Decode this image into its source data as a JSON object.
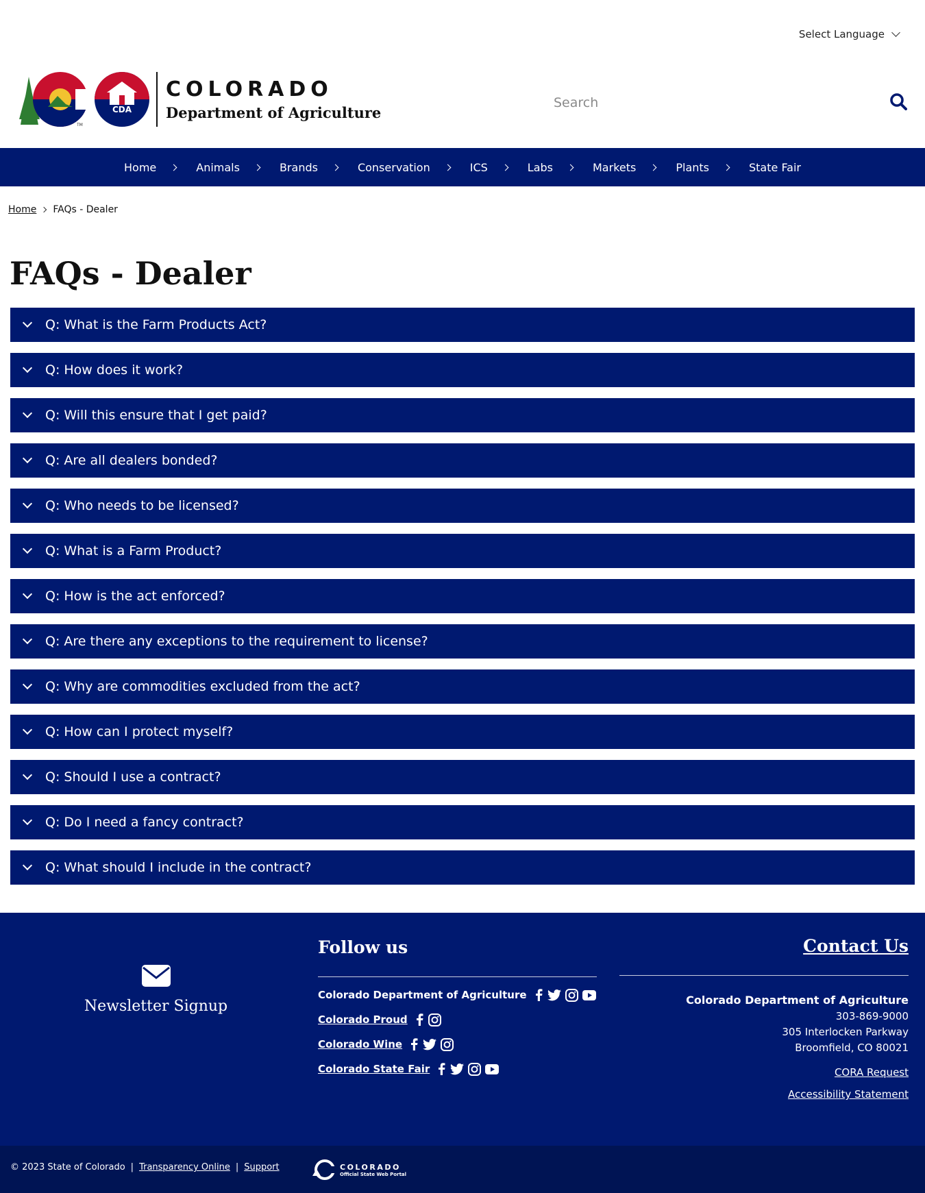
{
  "language": {
    "label": "Select Language",
    "icon": "chevron-down-icon"
  },
  "brand": {
    "line1": "COLORADO",
    "line2": "Department of Agriculture",
    "badge": "CDA"
  },
  "search": {
    "placeholder": "Search",
    "icon": "search-icon"
  },
  "nav": [
    {
      "label": "Home"
    },
    {
      "label": "Animals"
    },
    {
      "label": "Brands"
    },
    {
      "label": "Conservation"
    },
    {
      "label": "ICS"
    },
    {
      "label": "Labs"
    },
    {
      "label": "Markets"
    },
    {
      "label": "Plants"
    },
    {
      "label": "State Fair"
    }
  ],
  "breadcrumb": {
    "home": "Home",
    "current": "FAQs - Dealer"
  },
  "page_title": "FAQs - Dealer",
  "faqs": [
    "Q: What is the Farm Products Act?",
    "Q: How does it work?",
    "Q: Will this ensure that I get paid?",
    "Q: Are all dealers bonded?",
    "Q: Who needs to be licensed?",
    "Q: What is a Farm Product?",
    "Q: How is the act enforced?",
    "Q: Are there any exceptions to the requirement to license?",
    "Q: Why are commodities excluded from the act?",
    "Q: How can I protect myself?",
    "Q: Should I use a contract?",
    "Q: Do I need a fancy contract?",
    "Q: What should I include in the contract?"
  ],
  "footer": {
    "newsletter": "Newsletter Signup",
    "follow_title": "Follow us",
    "social": [
      {
        "name": "Colorado Department of Agriculture",
        "icons": [
          "facebook-icon",
          "twitter-icon",
          "instagram-icon",
          "youtube-icon"
        ]
      },
      {
        "name": "Colorado Proud",
        "icons": [
          "facebook-icon",
          "instagram-icon"
        ]
      },
      {
        "name": "Colorado Wine",
        "icons": [
          "facebook-icon",
          "twitter-icon",
          "instagram-icon"
        ]
      },
      {
        "name": "Colorado State Fair",
        "icons": [
          "facebook-icon",
          "twitter-icon",
          "instagram-icon",
          "youtube-icon"
        ]
      }
    ],
    "contact_title": "Contact Us",
    "contact_org": "Colorado Department of Agriculture",
    "phone": "303-869-9000",
    "address1": "305 Interlocken Parkway",
    "address2": "Broomfield, CO 80021",
    "cora": "CORA Request",
    "accessibility": "Accessibility Statement",
    "copyright": "© 2023 State of Colorado",
    "divider": "|",
    "transparency": "Transparency Online",
    "support": "Support",
    "portal_line1": "COLORADO",
    "portal_line2": "Official State Web Portal"
  },
  "colors": {
    "navy": "#001970",
    "footer_bottom": "#001454",
    "brand_red": "#c8102e",
    "brand_yellow": "#f2c230",
    "brand_green": "#2e7d32"
  }
}
